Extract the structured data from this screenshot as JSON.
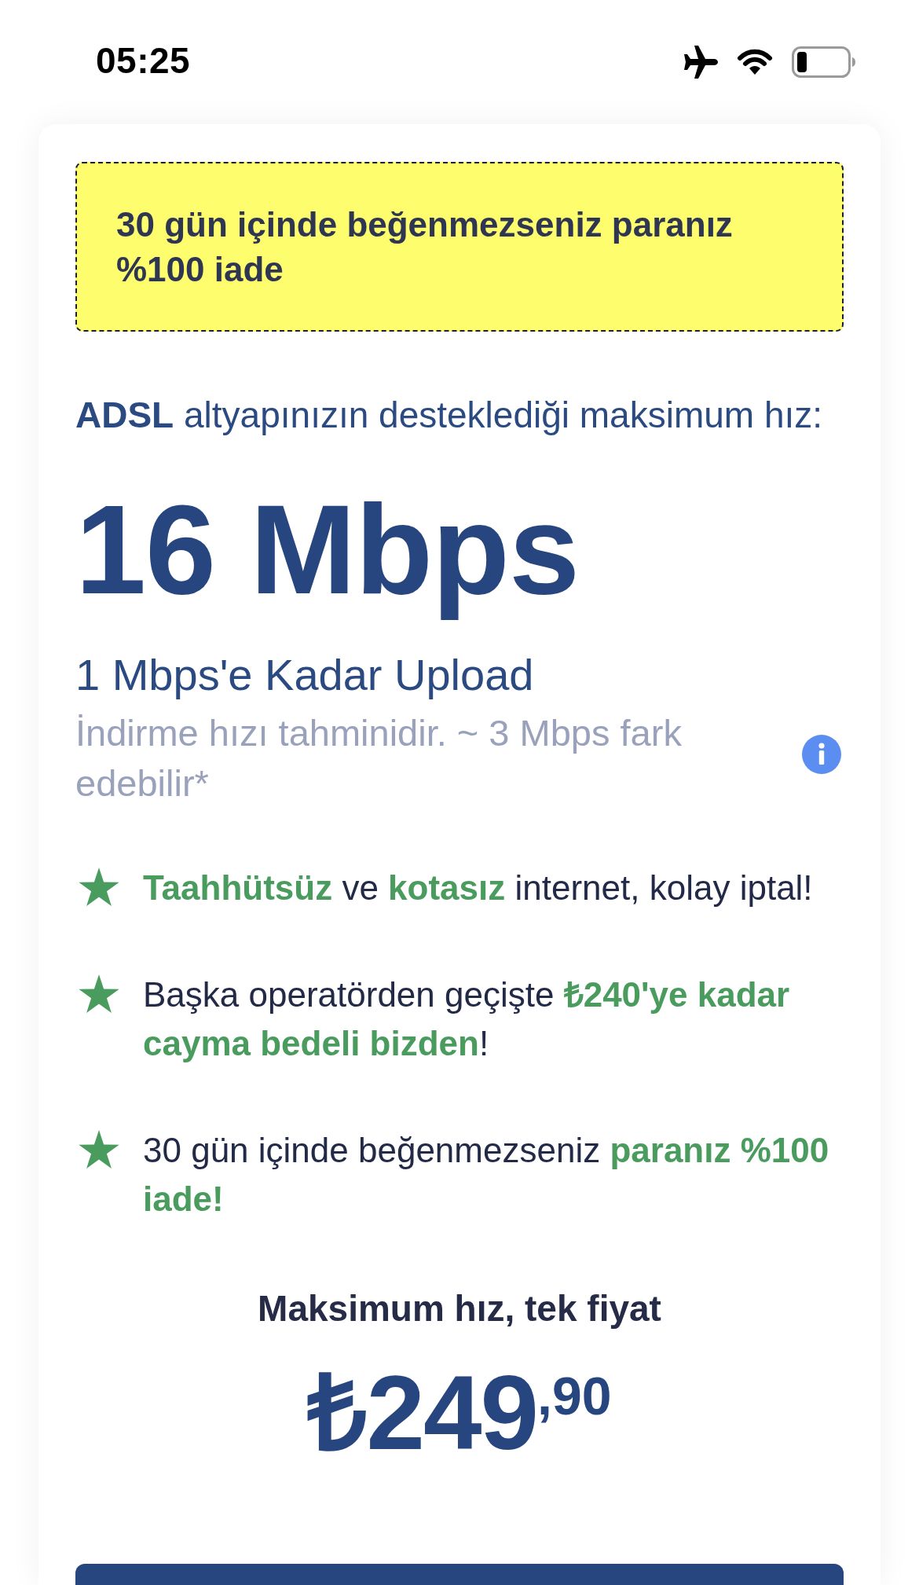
{
  "status_bar": {
    "time": "05:25"
  },
  "guarantee_banner": {
    "text": "30 gün içinde beğenmezseniz paranız %100 iade"
  },
  "speed": {
    "intro": "**ADSL** altyapınızın desteklediği maksimum hız:",
    "download": "16 Mbps",
    "upload": "1 Mbps'e Kadar Upload",
    "note": "İndirme hızı tahminidir. ~ 3 Mbps fark edebilir*"
  },
  "features": [
    {
      "text": "**Taahhütsüz** ve **kotasız** internet, kolay iptal!"
    },
    {
      "text": "Başka operatörden geçişte **₺240'ye kadar cayma bedeli bizden**!"
    },
    {
      "text": "30 gün içinde beğenmezseniz **paranız %100 iade!**"
    }
  ],
  "price": {
    "caption": "Maksimum hız, tek fiyat",
    "main": "₺249",
    "fraction": ",90"
  }
}
